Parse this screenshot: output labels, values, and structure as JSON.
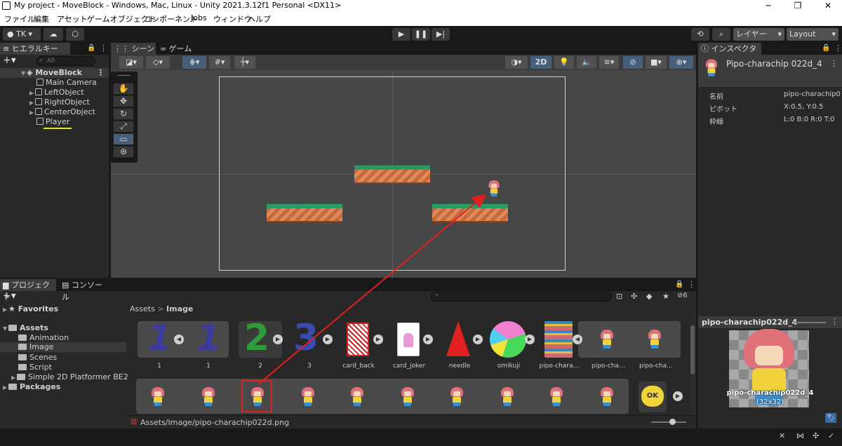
{
  "window": {
    "title": "My project - MoveBlock - Windows, Mac, Linux - Unity 2021.3.12f1 Personal <DX11>",
    "minimize": "─",
    "maximize": "❐",
    "close": "✕"
  },
  "menu": [
    "ファイル",
    "編集",
    "アセット",
    "ゲームオブジェクト",
    "コンポーネント",
    "Jobs",
    "ウィンドウ",
    "ヘルプ"
  ],
  "toolbar": {
    "account": "TK",
    "layers": "レイヤー",
    "layout": "Layout"
  },
  "hierarchy": {
    "tab": "ヒエラルキー",
    "search_placeholder": "All",
    "scene": "MoveBlock",
    "items": [
      "Main Camera",
      "LeftObject",
      "RightObject",
      "CenterObject",
      "Player"
    ]
  },
  "scene": {
    "tabs": [
      "シーン",
      "ゲーム"
    ],
    "mode_2d": "2D"
  },
  "inspector": {
    "tab": "インスペクター",
    "object_name": "Pipo-charachip 022d_4",
    "rows": [
      {
        "label": "名前",
        "value": "pipo-charachip0"
      },
      {
        "label": "ピボット",
        "value": "X:0.5, Y:0.5"
      },
      {
        "label": "枠線",
        "value": "L:0 B:0 R:0 T:0"
      }
    ]
  },
  "preview": {
    "title": "pipo-charachip022d_4",
    "caption_name": "pipo-charachip022d_4",
    "caption_size": "(32x32)"
  },
  "project": {
    "tabs": [
      "プロジェクト",
      "コンソール"
    ],
    "favorites": "Favorites",
    "assets": "Assets",
    "folders": [
      "Animation",
      "Image",
      "Scenes",
      "Script",
      "Simple 2D Platformer BE2"
    ],
    "packages": "Packages",
    "breadcrumb": [
      "Assets",
      "Image"
    ],
    "hidden_count": "6",
    "asset_names": [
      "1",
      "1",
      "2",
      "3",
      "card_back",
      "card_joker",
      "needle",
      "omikuji",
      "pipo-chara…",
      "pipo-cha…",
      "pipo-cha…"
    ],
    "glyphs": {
      "one": "1",
      "two": "2",
      "three": "3",
      "ok": "OK"
    },
    "path": "Assets/Image/pipo-charachip022d.png"
  }
}
